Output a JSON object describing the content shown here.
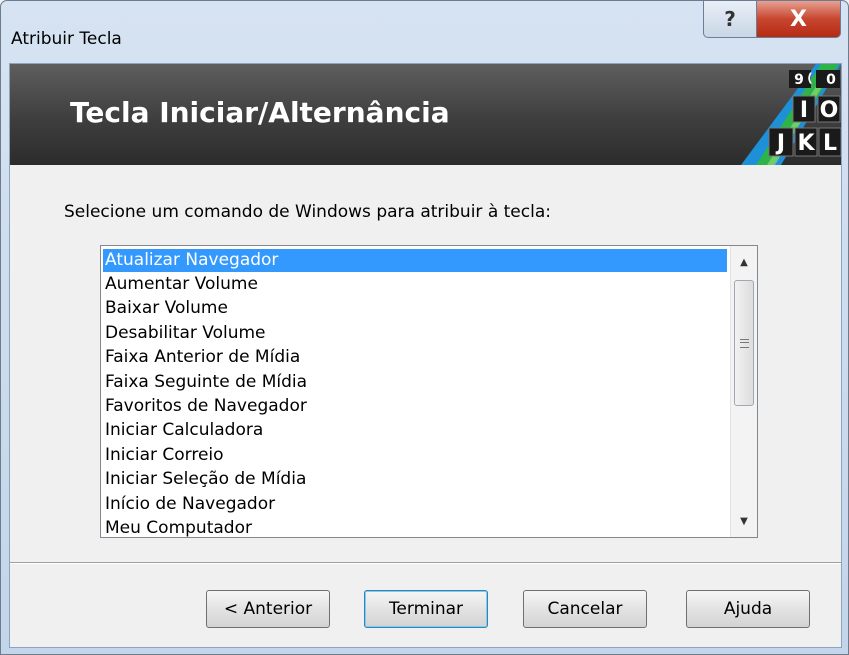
{
  "window": {
    "title": "Atribuir Tecla",
    "help_glyph": "?",
    "close_glyph": "X"
  },
  "banner": {
    "title": "Tecla Iniciar/Alternância",
    "key_letters": [
      "9",
      "(",
      "0",
      "I",
      "O",
      "J",
      "K",
      "L"
    ]
  },
  "prompt": "Selecione um comando de Windows para atribuir à tecla:",
  "list": {
    "items": [
      "Atualizar Navegador",
      "Aumentar Volume",
      "Baixar Volume",
      "Desabilitar Volume",
      "Faixa Anterior de Mídia",
      "Faixa Seguinte de Mídia",
      "Favoritos de Navegador",
      "Iniciar Calculadora",
      "Iniciar Correio",
      "Iniciar Seleção de Mídia",
      "Início de Navegador",
      "Meu Computador"
    ],
    "selected": "Atualizar Navegador",
    "scroll_up": "▲",
    "scroll_down": "▼"
  },
  "buttons": {
    "back": "< Anterior",
    "finish": "Terminar",
    "cancel": "Cancelar",
    "help": "Ajuda"
  },
  "colors": {
    "selection": "#3399ff",
    "banner": "#3e3e3e",
    "accent_green": "#2db34a",
    "accent_blue": "#1e90d8"
  }
}
